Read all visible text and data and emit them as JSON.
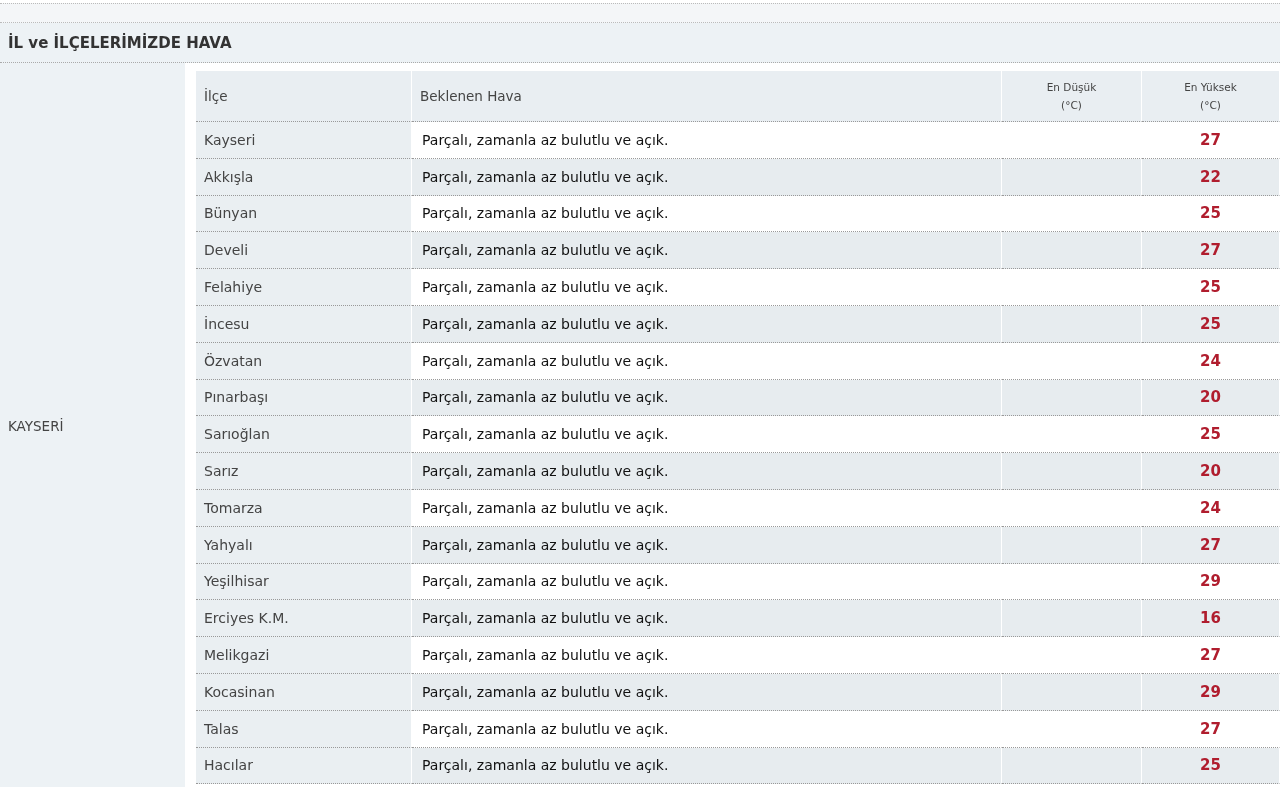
{
  "section_title": "İL ve İLÇELERİMİZDE HAVA",
  "province": "KAYSERİ",
  "table": {
    "columns": [
      {
        "label": "İlçe"
      },
      {
        "label": "Beklenen Hava"
      },
      {
        "label": "En Düşük",
        "unit": "(°C)"
      },
      {
        "label": "En Yüksek",
        "unit": "(°C)"
      }
    ],
    "rows": [
      {
        "district": "Kayseri",
        "forecast": "Parçalı, zamanla az bulutlu ve açık.",
        "high": "27"
      },
      {
        "district": "Akkışla",
        "forecast": "Parçalı, zamanla az bulutlu ve açık.",
        "high": "22"
      },
      {
        "district": "Bünyan",
        "forecast": "Parçalı, zamanla az bulutlu ve açık.",
        "high": "25"
      },
      {
        "district": "Develi",
        "forecast": "Parçalı, zamanla az bulutlu ve açık.",
        "high": "27"
      },
      {
        "district": "Felahiye",
        "forecast": "Parçalı, zamanla az bulutlu ve açık.",
        "high": "25"
      },
      {
        "district": "İncesu",
        "forecast": "Parçalı, zamanla az bulutlu ve açık.",
        "high": "25"
      },
      {
        "district": "Özvatan",
        "forecast": "Parçalı, zamanla az bulutlu ve açık.",
        "high": "24"
      },
      {
        "district": "Pınarbaşı",
        "forecast": "Parçalı, zamanla az bulutlu ve açık.",
        "high": "20"
      },
      {
        "district": "Sarıoğlan",
        "forecast": "Parçalı, zamanla az bulutlu ve açık.",
        "high": "25"
      },
      {
        "district": "Sarız",
        "forecast": "Parçalı, zamanla az bulutlu ve açık.",
        "high": "20"
      },
      {
        "district": "Tomarza",
        "forecast": "Parçalı, zamanla az bulutlu ve açık.",
        "high": "24"
      },
      {
        "district": "Yahyalı",
        "forecast": "Parçalı, zamanla az bulutlu ve açık.",
        "high": "27"
      },
      {
        "district": "Yeşilhisar",
        "forecast": "Parçalı, zamanla az bulutlu ve açık.",
        "high": "29"
      },
      {
        "district": "Erciyes K.M.",
        "forecast": "Parçalı, zamanla az bulutlu ve açık.",
        "high": "16"
      },
      {
        "district": "Melikgazi",
        "forecast": "Parçalı, zamanla az bulutlu ve açık.",
        "high": "27"
      },
      {
        "district": "Kocasinan",
        "forecast": "Parçalı, zamanla az bulutlu ve açık.",
        "high": "29"
      },
      {
        "district": "Talas",
        "forecast": "Parçalı, zamanla az bulutlu ve açık.",
        "high": "27"
      },
      {
        "district": "Hacılar",
        "forecast": "Parçalı, zamanla az bulutlu ve açık.",
        "high": "25"
      }
    ]
  }
}
